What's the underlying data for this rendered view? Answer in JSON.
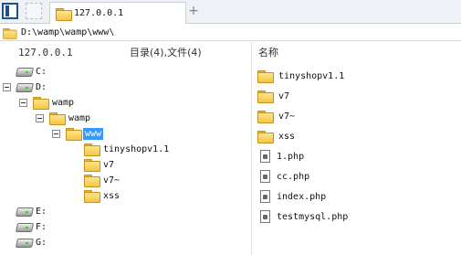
{
  "tab": {
    "title": "127.0.0.1",
    "new_tab": "+"
  },
  "address": {
    "path": "D:\\wamp\\wamp\\www\\"
  },
  "header": {
    "left_host": "127.0.0.1",
    "left_summary": "目录(4),文件(4)",
    "right_name": "名称"
  },
  "tree": {
    "drive_c": "C:",
    "drive_d": "D:",
    "wamp1": "wamp",
    "wamp2": "wamp",
    "www": "www",
    "sub1": "tinyshopv1.1",
    "sub2": "v7",
    "sub3": "v7~",
    "sub4": "xss",
    "drive_e": "E:",
    "drive_f": "F:",
    "drive_g": "G:"
  },
  "list": {
    "items": [
      {
        "name": "tinyshopv1.1",
        "kind": "folder"
      },
      {
        "name": "v7",
        "kind": "folder"
      },
      {
        "name": "v7~",
        "kind": "folder"
      },
      {
        "name": "xss",
        "kind": "folder"
      },
      {
        "name": "1.php",
        "kind": "file"
      },
      {
        "name": "cc.php",
        "kind": "file"
      },
      {
        "name": "index.php",
        "kind": "file"
      },
      {
        "name": "testmysql.php",
        "kind": "file"
      }
    ]
  },
  "colors": {
    "selection": "#3399ff",
    "folder": "#f3c545"
  }
}
